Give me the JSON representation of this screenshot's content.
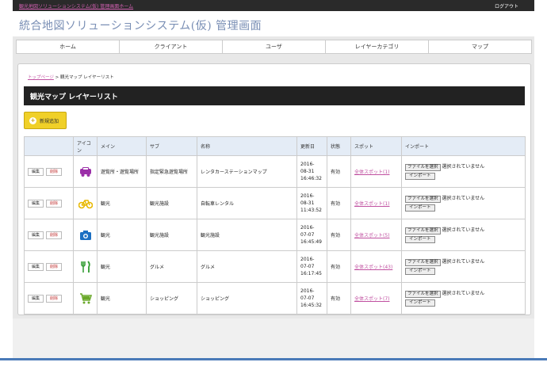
{
  "topbar": {
    "home_link": "観光地図ソリューションシステム(仮) 管理画面ホーム",
    "logout": "ログアウト"
  },
  "app_title": "統合地図ソリューションシステム(仮) 管理画面",
  "nav": {
    "items": [
      {
        "label": "ホーム"
      },
      {
        "label": "クライアント"
      },
      {
        "label": "ユーザ"
      },
      {
        "label": "レイヤーカテゴリ"
      },
      {
        "label": "マップ"
      }
    ]
  },
  "breadcrumb": {
    "link": "トップページ",
    "separator": " > ",
    "current": "観光マップ レイヤーリスト"
  },
  "section_title": "観光マップ レイヤーリスト",
  "add_button": {
    "icon": "+",
    "label": "新規追加"
  },
  "table": {
    "headers": [
      "",
      "アイコン",
      "メイン",
      "サブ",
      "名称",
      "更新日",
      "状態",
      "スポット",
      "インポート"
    ],
    "edit_label": "編集",
    "delete_label": "削除",
    "file_button": "ファイルを選択",
    "file_status": "選択されていません",
    "import_button": "インポート",
    "rows": [
      {
        "icon": "car-icon",
        "icon_color": "#9b2fa8",
        "main": "遊覧所・遊覧場所",
        "sub": "指定緊急遊覧場所",
        "name": "レンタカーステーションマップ",
        "date1": "2016-",
        "date2": "08-31",
        "date3": "16:46:32",
        "status": "有効",
        "spot": "全体スポット(1)"
      },
      {
        "icon": "bicycle-icon",
        "icon_color": "#e8b800",
        "main": "観光",
        "sub": "観光施設",
        "name": "自転車レンタル",
        "date1": "2016-",
        "date2": "08-31",
        "date3": "11:43:52",
        "status": "有効",
        "spot": "全体スポット(1)"
      },
      {
        "icon": "camera-icon",
        "icon_color": "#1c6fc2",
        "main": "観光",
        "sub": "観光施設",
        "name": "観光施設",
        "date1": "2016-",
        "date2": "07-07",
        "date3": "16:45:49",
        "status": "有効",
        "spot": "全体スポット(5)"
      },
      {
        "icon": "fork-knife-icon",
        "icon_color": "#2e9a2e",
        "main": "観光",
        "sub": "グルメ",
        "name": "グルメ",
        "date1": "2016-",
        "date2": "07-07",
        "date3": "16:17:45",
        "status": "有効",
        "spot": "全体スポット(43)"
      },
      {
        "icon": "cart-icon",
        "icon_color": "#6aa82a",
        "main": "観光",
        "sub": "ショッピング",
        "name": "ショッピング",
        "date1": "2016-",
        "date2": "07-07",
        "date3": "16:45:32",
        "status": "有効",
        "spot": "全体スポット(7)"
      }
    ]
  }
}
